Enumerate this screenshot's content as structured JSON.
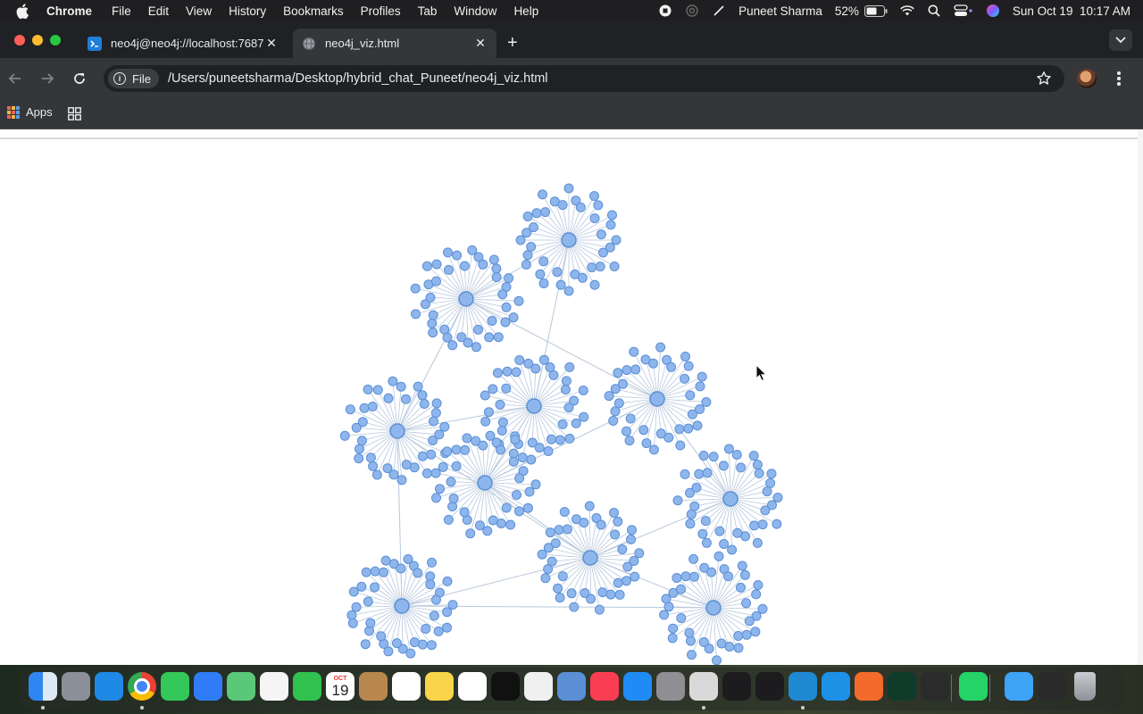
{
  "menubar": {
    "app_name": "Chrome",
    "items": [
      "File",
      "Edit",
      "View",
      "History",
      "Bookmarks",
      "Profiles",
      "Tab",
      "Window",
      "Help"
    ],
    "user": "Puneet Sharma",
    "battery": "52%",
    "datetime": "Sun Oct 19  10:17 AM",
    "status_icons": [
      "screen-record-icon",
      "airplay-icon",
      "pen-icon",
      "battery-icon",
      "wifi-icon",
      "spotlight-icon",
      "control-center-icon",
      "siri-icon"
    ]
  },
  "tabs": [
    {
      "title": "neo4j@neo4j://localhost:7687",
      "icon": "terminal-icon",
      "active": false
    },
    {
      "title": "neo4j_viz.html",
      "icon": "globe-icon",
      "active": true
    }
  ],
  "toolbar": {
    "chip_label": "File",
    "url": "/Users/puneetsharma/Desktop/hybrid_chat_Puneet/neo4j_viz.html"
  },
  "bookmarks": {
    "apps_label": "Apps"
  },
  "graph": {
    "node_color": "#8fb6ec",
    "node_stroke": "#5b8fd6",
    "edge_color": "#b8c8dc",
    "clusters": [
      {
        "id": "c1",
        "leaves": 36
      },
      {
        "id": "c2",
        "leaves": 38
      },
      {
        "id": "c3",
        "leaves": 36
      },
      {
        "id": "c4",
        "leaves": 36
      },
      {
        "id": "c5",
        "leaves": 36
      },
      {
        "id": "c6",
        "leaves": 38
      },
      {
        "id": "c7",
        "leaves": 38
      },
      {
        "id": "c8",
        "leaves": 36
      },
      {
        "id": "c9",
        "leaves": 40
      },
      {
        "id": "c10",
        "leaves": 38
      }
    ],
    "links": [
      [
        "c1",
        "c2"
      ],
      [
        "c1",
        "c3"
      ],
      [
        "c2",
        "c4"
      ],
      [
        "c2",
        "c5"
      ],
      [
        "c3",
        "c5"
      ],
      [
        "c4",
        "c6"
      ],
      [
        "c4",
        "c8"
      ],
      [
        "c3",
        "c6"
      ],
      [
        "c5",
        "c7"
      ],
      [
        "c5",
        "c9"
      ],
      [
        "c6",
        "c7"
      ],
      [
        "c7",
        "c8"
      ],
      [
        "c7",
        "c10"
      ],
      [
        "c9",
        "c10"
      ],
      [
        "c7",
        "c9"
      ]
    ]
  },
  "dock": {
    "apps": [
      {
        "name": "finder-icon",
        "color": "#3b8ff3",
        "running": true
      },
      {
        "name": "launchpad-icon",
        "color": "#8a8f99",
        "running": false
      },
      {
        "name": "safari-icon",
        "color": "#1e88e5",
        "running": false
      },
      {
        "name": "chrome-icon",
        "color": "#e8eaed",
        "running": true
      },
      {
        "name": "messages-icon",
        "color": "#34c759",
        "running": false
      },
      {
        "name": "mail-icon",
        "color": "#2f7cf6",
        "running": false
      },
      {
        "name": "maps-icon",
        "color": "#5ac878",
        "running": false
      },
      {
        "name": "photos-icon",
        "color": "#f5f5f5",
        "running": false
      },
      {
        "name": "facetime-icon",
        "color": "#30c14e",
        "running": false
      },
      {
        "name": "calendar-icon",
        "color": "#ffffff",
        "running": false
      },
      {
        "name": "contacts-icon",
        "color": "#b8874e",
        "running": false
      },
      {
        "name": "reminders-icon",
        "color": "#ffffff",
        "running": false
      },
      {
        "name": "notes-icon",
        "color": "#f7d44a",
        "running": false
      },
      {
        "name": "freeform-icon",
        "color": "#ffffff",
        "running": false
      },
      {
        "name": "tv-icon",
        "color": "#111111",
        "running": false
      },
      {
        "name": "textedit-icon",
        "color": "#f0f0f0",
        "running": false
      },
      {
        "name": "preview-icon",
        "color": "#5a8fd6",
        "running": false
      },
      {
        "name": "music-icon",
        "color": "#fa3d52",
        "running": false
      },
      {
        "name": "app-store-icon",
        "color": "#1f8cf5",
        "running": false
      },
      {
        "name": "system-settings-icon",
        "color": "#8e8e93",
        "running": false
      },
      {
        "name": "disk-utility-icon",
        "color": "#d9d9d9",
        "running": true
      },
      {
        "name": "activity-monitor-icon",
        "color": "#1c1c1e",
        "running": false
      },
      {
        "name": "terminal-icon",
        "color": "#1c1c1e",
        "running": false
      },
      {
        "name": "vscode-icon",
        "color": "#1f8ad2",
        "running": true
      },
      {
        "name": "docker-icon",
        "color": "#1d91e6",
        "running": false
      },
      {
        "name": "pen-app-icon",
        "color": "#f26b2a",
        "running": false
      },
      {
        "name": "mongodb-icon",
        "color": "#0f3b2a",
        "running": false
      },
      {
        "name": "speedometer-icon",
        "color": "#2b2b2b",
        "running": false
      },
      {
        "name": "whatsapp-icon",
        "color": "#25d366",
        "running": false
      },
      {
        "name": "folder-icon",
        "color": "#3fa3f5",
        "running": false
      },
      {
        "name": "window-icon",
        "color": "#2a2a2a",
        "running": false
      },
      {
        "name": "trash-icon",
        "color": "#9ea3a8",
        "running": false
      }
    ],
    "calendar": {
      "month": "OCT",
      "day": "19"
    }
  }
}
